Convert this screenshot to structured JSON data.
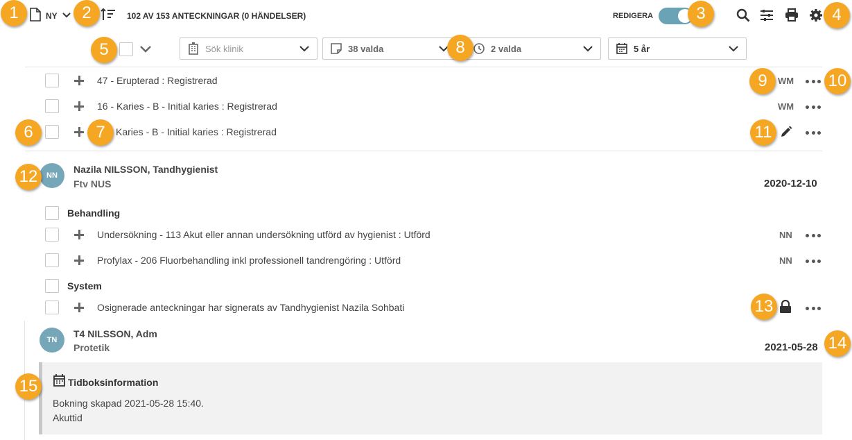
{
  "toolbar": {
    "new_label": "NY",
    "notes_count": "102 AV 153 ANTECKNINGAR (0 HÄNDELSER)",
    "edit_label": "REDIGERA"
  },
  "filters": {
    "clinic_placeholder": "Sök klinik",
    "notes_selected": "38 valda",
    "time_selected": "2 valda",
    "period": "5 år"
  },
  "badges": [
    "1",
    "2",
    "3",
    "4",
    "5",
    "6",
    "7",
    "8",
    "9",
    "10",
    "11",
    "12",
    "13",
    "14",
    "15"
  ],
  "first_group": {
    "rows": [
      {
        "text": "47 - Erupterad : Registrerad",
        "initials": "WM"
      },
      {
        "text": "16 - Karies - B - Initial karies : Registrerad",
        "initials": "WM"
      },
      {
        "text": "Karies - B - Initial karies : Registrerad",
        "initials": ""
      }
    ]
  },
  "entry1": {
    "avatar": "NN",
    "author": "Nazila NILSSON, Tandhygienist",
    "dept": "Ftv NUS",
    "date": "2020-12-10",
    "groups": [
      {
        "label": "Behandling"
      },
      {
        "label": "System"
      }
    ],
    "rows": [
      {
        "text": "Undersökning - 113 Akut eller annan undersökning utförd av hygienist : Utförd",
        "initials": "NN"
      },
      {
        "text": "Profylax - 206 Fluorbehandling inkl professionell tandrengöring : Utförd",
        "initials": "NN"
      },
      {
        "text": "Osignerade anteckningar har signerats av Tandhygienist Nazila Sohbati",
        "initials": ""
      }
    ]
  },
  "entry2": {
    "avatar": "TN",
    "author": "T4 NILSSON, Adm",
    "dept": "Protetik",
    "date": "2021-05-28",
    "info_title": "Tidboksinformation",
    "info_line1": "Bokning skapad 2021-05-28 15:40.",
    "info_line2": "Akuttid"
  },
  "colors": {
    "badge": "#f5a623",
    "toggle": "#6aa3b5",
    "avatar": "#76a7b8"
  }
}
